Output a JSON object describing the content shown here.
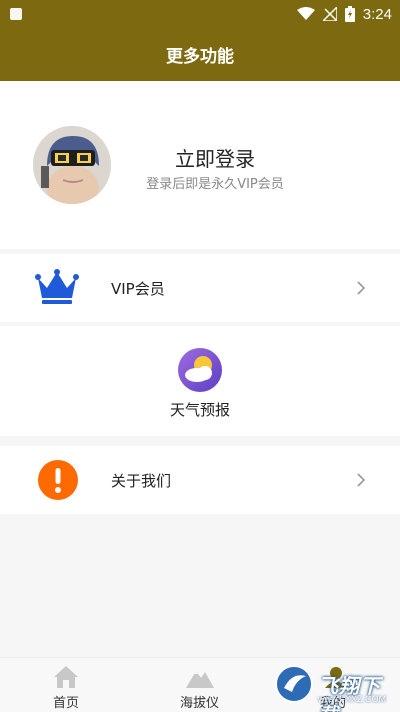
{
  "status_bar": {
    "time": "3:24"
  },
  "header": {
    "title": "更多功能"
  },
  "profile": {
    "login_title": "立即登录",
    "login_subtitle": "登录后即是永久VIP会员"
  },
  "menu": {
    "vip_label": "VIP会员",
    "weather_label": "天气预报",
    "about_label": "关于我们"
  },
  "tabs": [
    {
      "label": "首页",
      "icon": "home-icon"
    },
    {
      "label": "海拔仪",
      "icon": "mountain-icon"
    },
    {
      "label": "我的",
      "icon": "profile-icon"
    }
  ],
  "watermark": {
    "text": "飞翔下载",
    "url": "www.FXXZ.COM"
  },
  "colors": {
    "brand": "#7d6a10",
    "vip_crown": "#1f5bd8",
    "about_icon": "#ff6a00"
  }
}
